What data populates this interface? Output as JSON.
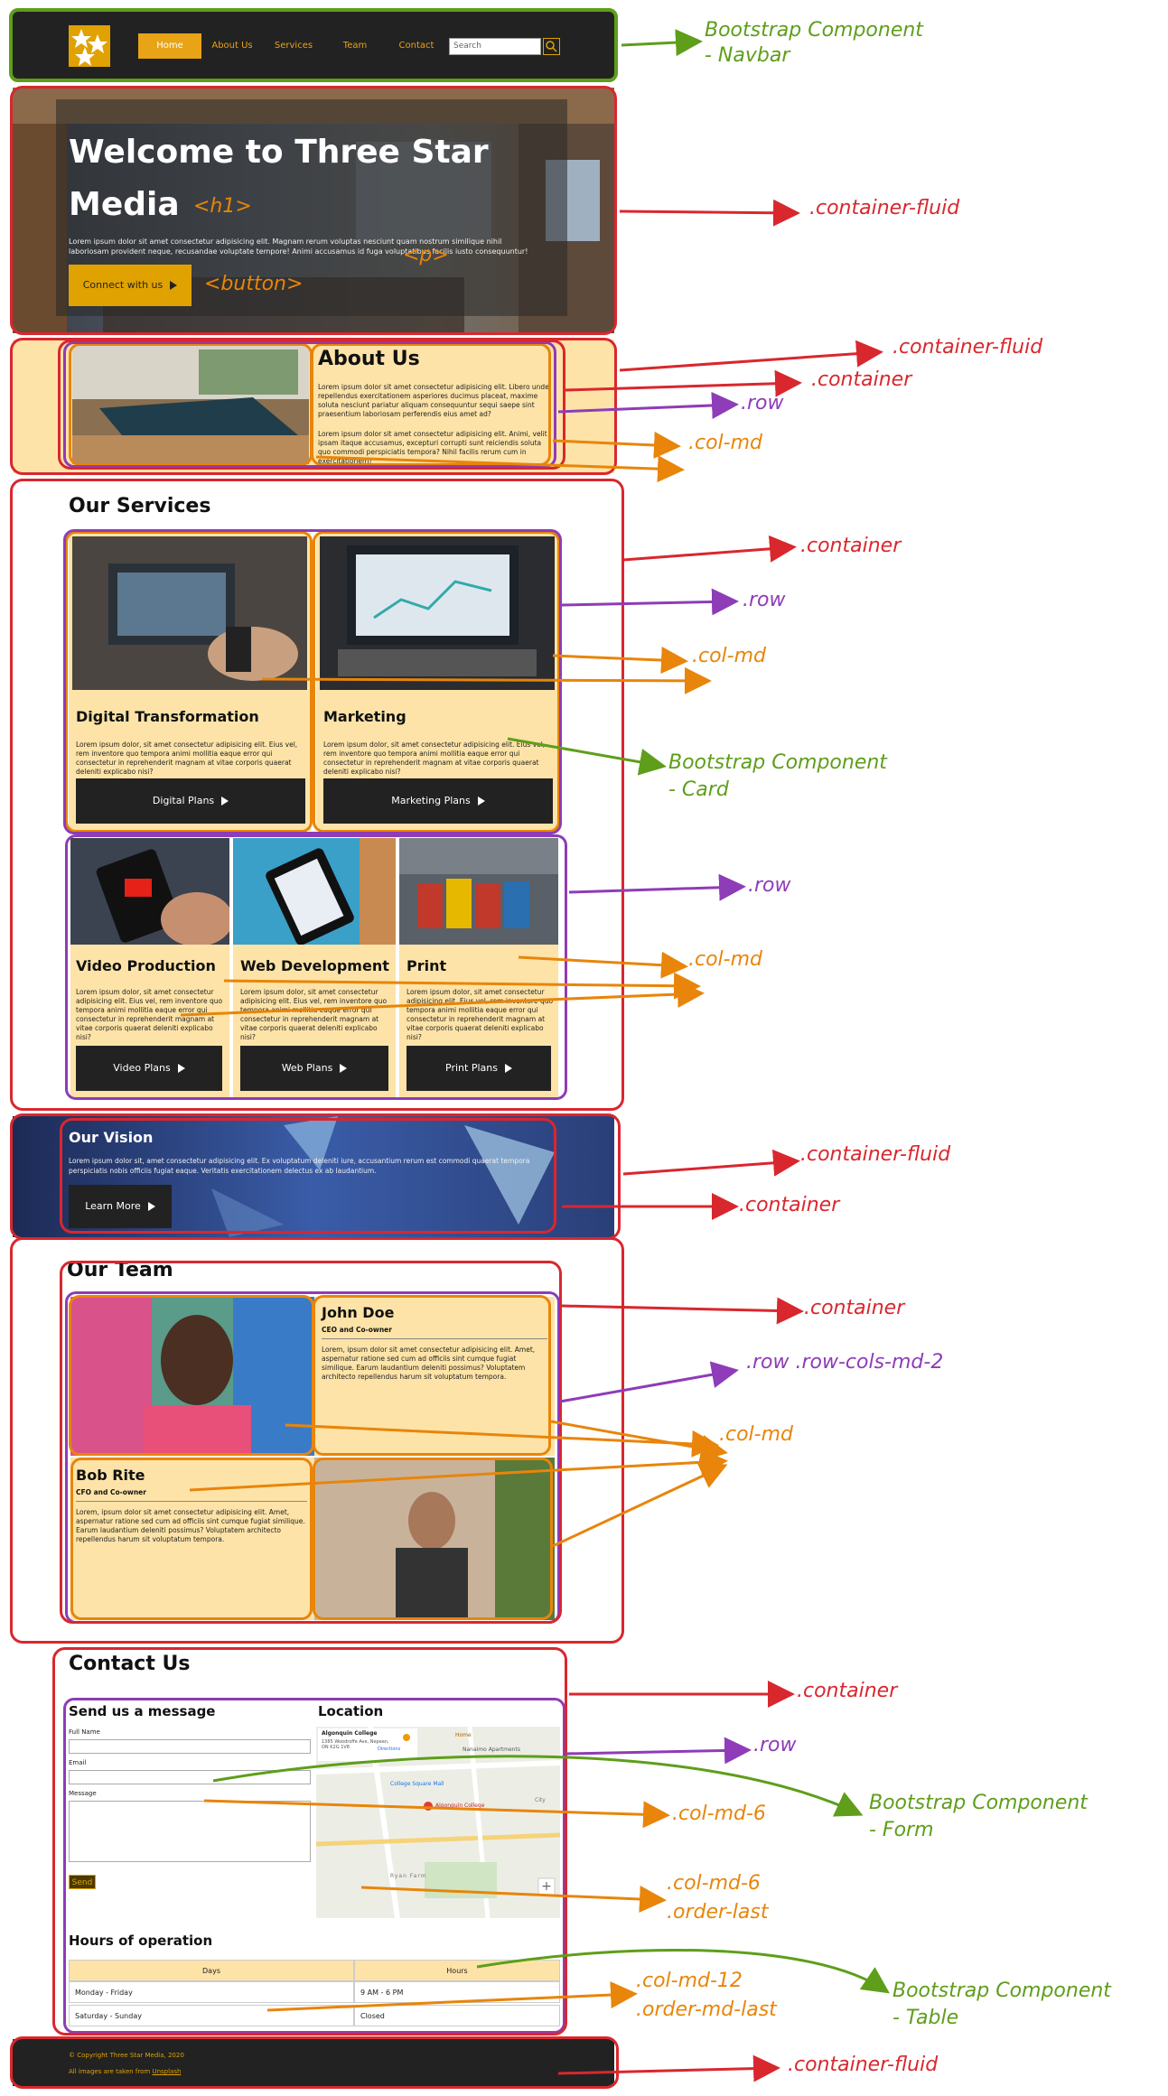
{
  "navbar": {
    "items": [
      "Home",
      "About Us",
      "Services",
      "Team",
      "Contact"
    ],
    "search_placeholder": "Search"
  },
  "hero": {
    "title_line1": "Welcome to Three Star",
    "title_line2": "Media",
    "paragraph": "Lorem ipsum dolor sit amet consectetur adipisicing elit. Magnam rerum voluptas nesciunt quam nostrum similique nihil laboriosam provident neque, recusandae voluptate tempore! Animi accusamus id fuga voluptatibus facilis iusto consequuntur!",
    "button": "Connect with us"
  },
  "about": {
    "title": "About Us",
    "p1": "Lorem ipsum dolor sit amet consectetur adipisicing elit. Libero unde repellendus exercitationem asperiores ducimus placeat, maxime soluta nesciunt pariatur aliquam consequuntur sequi saepe sint praesentium laboriosam perferendis eius amet ad?",
    "p2": "Lorem ipsum dolor sit amet consectetur adipisicing elit. Animi, velit ipsam itaque accusamus, excepturi corrupti sunt reiciendis soluta quo commodi perspiciatis tempora? Nihil facilis rerum cum in exercitationem?"
  },
  "services": {
    "title": "Our Services",
    "card_text": "Lorem ipsum dolor, sit amet consectetur adipisicing elit. Eius vel, rem inventore quo tempora animi mollitia eaque error qui consectetur in reprehenderit magnam at vitae corporis quaerat deleniti explicabo nisi?",
    "cards": [
      {
        "title": "Digital Transformation",
        "button": "Digital Plans"
      },
      {
        "title": "Marketing",
        "button": "Marketing Plans"
      },
      {
        "title": "Video Production",
        "button": "Video Plans"
      },
      {
        "title": "Web Development",
        "button": "Web Plans"
      },
      {
        "title": "Print",
        "button": "Print Plans"
      }
    ]
  },
  "vision": {
    "title": "Our Vision",
    "text": "Lorem ipsum dolor sit, amet consectetur adipisicing elit. Ex voluptatum deleniti iure, accusantium rerum est commodi quaerat tempora perspiciatis nobis officiis fugiat eaque. Veritatis exercitationem delectus ex ab laudantium.",
    "button": "Learn More"
  },
  "team": {
    "title": "Our Team",
    "members": [
      {
        "name": "John Doe",
        "role": "CEO and Co-owner"
      },
      {
        "name": "Bob Rite",
        "role": "CFO and Co-owner"
      }
    ],
    "bio": "Lorem, ipsum dolor sit amet consectetur adipisicing elit. Amet, aspernatur ratione sed cum ad officiis sint cumque fugiat similique. Earum laudantium deleniti possimus? Voluptatem architecto repellendus harum sit voluptatum tempora."
  },
  "contact": {
    "title": "Contact Us",
    "form_title": "Send us a message",
    "label_name": "Full Name",
    "label_email": "Email",
    "label_message": "Message",
    "send": "Send",
    "location_title": "Location",
    "map_place": "Algonquin College",
    "map_address": "1385 Woodroffe Ave, Nepean, ON K2G 1V8",
    "map_directions": "Directions",
    "map_label1": "Home",
    "map_label2": "Nanaimo Apartments",
    "map_label3": "College Square Mall",
    "map_label4": "Algonquin College",
    "map_label5": "Ryan Farm",
    "map_label6": "City",
    "hours_title": "Hours of operation",
    "table_headers": [
      "Days",
      "Hours"
    ],
    "table_rows": [
      [
        "Monday - Friday",
        "9 AM - 6 PM"
      ],
      [
        "Saturday - Sunday",
        "Closed"
      ]
    ]
  },
  "footer": {
    "copyright": "© Copyright Three Star Media, 2020",
    "images_prefix": "All images are taken from ",
    "images_link": "Unsplash"
  },
  "annotations": {
    "navbar": [
      "Bootstrap Component",
      "- Navbar"
    ],
    "hero_container": ".container-fluid",
    "h1": "<h1>",
    "p": "<p>",
    "button": "<button>",
    "about_fluid": ".container-fluid",
    "about_container": ".container",
    "about_row": ".row",
    "about_col": ".col-md",
    "services_container": ".container",
    "services_row1": ".row",
    "services_col1": ".col-md",
    "card": [
      "Bootstrap Component",
      "- Card"
    ],
    "services_row2": ".row",
    "services_col2": ".col-md",
    "vision_fluid": ".container-fluid",
    "vision_container": ".container",
    "team_container": ".container",
    "team_row": ".row .row-cols-md-2",
    "team_col": ".col-md",
    "contact_container": ".container",
    "contact_row": ".row",
    "form": [
      "Bootstrap Component",
      "- Form"
    ],
    "col_md_6": ".col-md-6",
    "col_md_6_order": [
      ".col-md-6",
      ".order-last"
    ],
    "table": [
      "Bootstrap Component",
      "- Table"
    ],
    "col_md_12": [
      ".col-md-12",
      ".order-md-last"
    ],
    "footer_fluid": ".container-fluid"
  },
  "colors": {
    "red": "#d9272e",
    "purple": "#8e3cb7",
    "orange": "#e8850a",
    "green": "#5e9e1a",
    "gold": "#e0a200",
    "peach": "#fde3a7"
  }
}
